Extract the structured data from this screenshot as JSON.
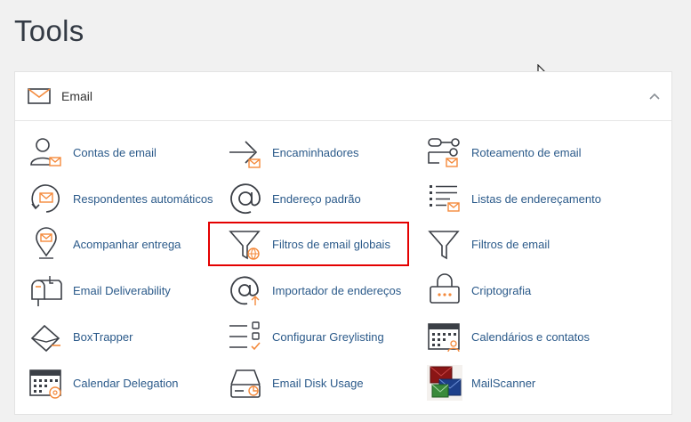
{
  "page": {
    "title": "Tools"
  },
  "panel": {
    "title": "Email",
    "header_icon": "envelope-icon",
    "toggle_icon": "chevron-up-icon"
  },
  "items": [
    {
      "label": "Contas de email",
      "icon": "email-accounts-icon"
    },
    {
      "label": "Encaminhadores",
      "icon": "forwarders-icon"
    },
    {
      "label": "Roteamento de email",
      "icon": "email-routing-icon"
    },
    {
      "label": "Respondentes automáticos",
      "icon": "autoresponders-icon"
    },
    {
      "label": "Endereço padrão",
      "icon": "default-address-icon"
    },
    {
      "label": "Listas de endereçamento",
      "icon": "mailing-lists-icon"
    },
    {
      "label": "Acompanhar entrega",
      "icon": "track-delivery-icon"
    },
    {
      "label": "Filtros de email globais",
      "icon": "global-email-filters-icon"
    },
    {
      "label": "Filtros de email",
      "icon": "email-filters-icon"
    },
    {
      "label": "Email Deliverability",
      "icon": "email-deliverability-icon"
    },
    {
      "label": "Importador de endereços",
      "icon": "address-importer-icon"
    },
    {
      "label": "Criptografia",
      "icon": "encryption-icon"
    },
    {
      "label": "BoxTrapper",
      "icon": "boxtrapper-icon"
    },
    {
      "label": "Configurar Greylisting",
      "icon": "greylisting-icon"
    },
    {
      "label": "Calendários e contatos",
      "icon": "calendars-contacts-icon"
    },
    {
      "label": "Calendar Delegation",
      "icon": "calendar-delegation-icon"
    },
    {
      "label": "Email Disk Usage",
      "icon": "email-disk-usage-icon"
    },
    {
      "label": "MailScanner",
      "icon": "mailscanner-icon"
    }
  ],
  "colors": {
    "accent": "#f48a3c",
    "link": "#2b5a8a",
    "highlight": "#e40000",
    "icon_stroke": "#3b3f46"
  }
}
